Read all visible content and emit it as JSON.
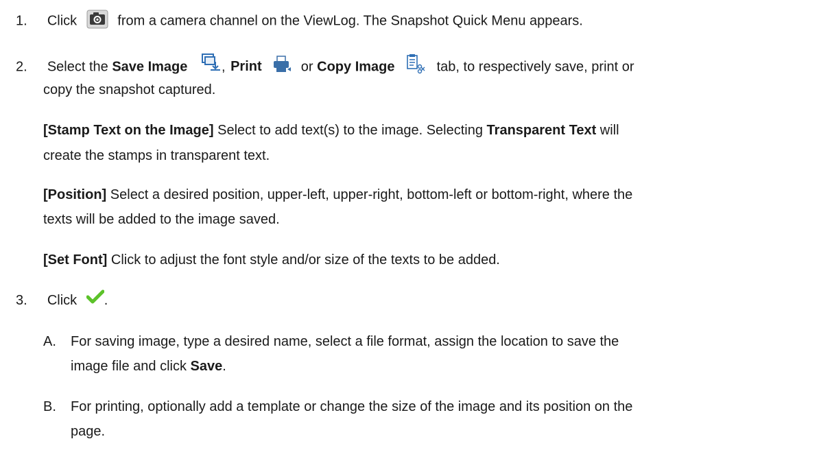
{
  "steps": [
    {
      "num": "1.",
      "pre": "Click",
      "icon": "camera-icon",
      "post": "from a camera channel on the ViewLog. The Snapshot Quick Menu appears."
    },
    {
      "num": "2.",
      "pre": "Select the",
      "tabs": [
        {
          "label": "Save Image",
          "icon": "save-image-icon"
        },
        {
          "label": "Print",
          "icon": "printer-icon"
        },
        {
          "label": "Copy Image",
          "icon": "copy-image-icon"
        }
      ],
      "sep1": ",",
      "sep2": "or",
      "line1_end": "tab, to respectively save, print or",
      "line2": "copy the snapshot captured.",
      "options": [
        {
          "label": "[Stamp Text on the Image]",
          "text1a": "Select to add text(s) to the image. Selecting",
          "bold": "Transparent Text",
          "text1b": "will",
          "text2": "create the stamps in transparent text."
        },
        {
          "label": "[Position]",
          "text1a": "Select a desired position, upper-left, upper-right, bottom-left or bottom-right, where the",
          "text2": "texts will be added to the image saved."
        },
        {
          "label": "[Set Font]",
          "text1a": "Click to adjust the font style and/or size of the texts to be added."
        }
      ]
    },
    {
      "num": "3.",
      "pre": "Click",
      "icon": "checkmark-icon",
      "post": ".",
      "sub": [
        {
          "letter": "A.",
          "line1": "For saving image, type a desired name, select a file format, assign the location to save the",
          "line2_pre": "image file and click",
          "line2_bold": "Save",
          "line2_post": "."
        },
        {
          "letter": "B.",
          "line1": "For printing, optionally add a template or change the size of the image and its position on the",
          "line2": "page."
        }
      ]
    }
  ],
  "colors": {
    "text": "#1a1a1a",
    "icon_blue": "#2f6fb5",
    "check_green": "#5cc22a"
  }
}
